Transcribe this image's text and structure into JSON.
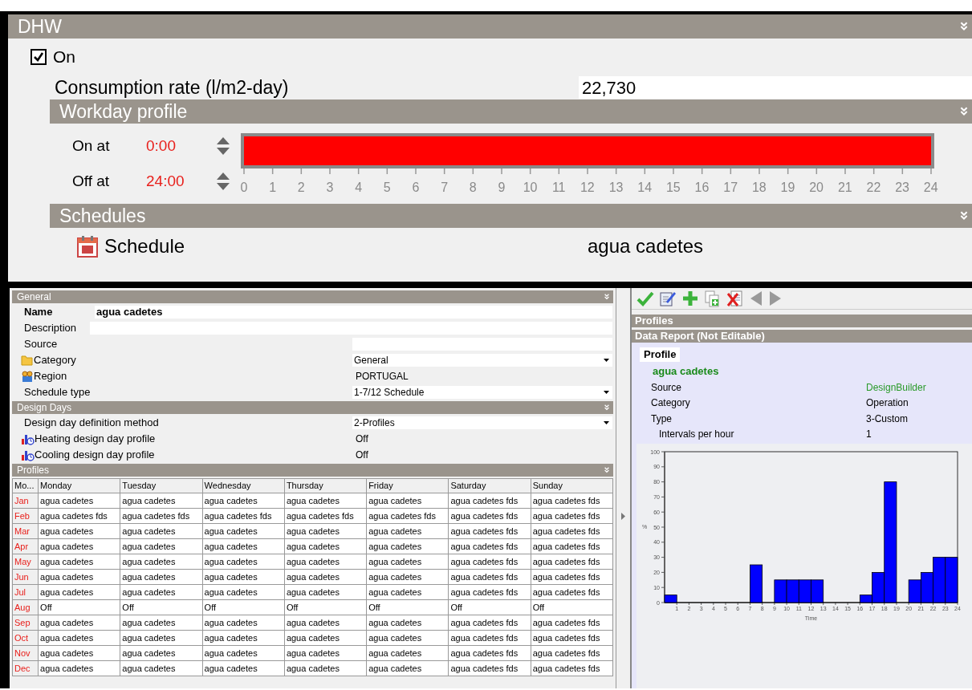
{
  "dhw": {
    "title": "DHW",
    "on": {
      "label": "On",
      "checked": true
    },
    "consumption": {
      "label": "Consumption rate (l/m2-day)",
      "value": "22,730"
    },
    "workday": {
      "title": "Workday profile",
      "on_label": "On at",
      "on_value": "0:00",
      "off_label": "Off at",
      "off_value": "24:00",
      "level": 1,
      "ticks": [
        "0",
        "1",
        "2",
        "3",
        "4",
        "5",
        "6",
        "7",
        "8",
        "9",
        "10",
        "11",
        "12",
        "13",
        "14",
        "15",
        "16",
        "17",
        "18",
        "19",
        "20",
        "21",
        "22",
        "23",
        "24"
      ]
    },
    "schedules": {
      "title": "Schedules",
      "label": "Schedule",
      "value": "agua cadetes"
    }
  },
  "general": {
    "title": "General",
    "fields": [
      {
        "label": "Name",
        "value": "agua cadetes",
        "kind": "name"
      },
      {
        "label": "Description",
        "kind": "wide"
      },
      {
        "label": "Source",
        "kind": "field"
      },
      {
        "label": "Category",
        "value": "General",
        "kind": "dropdown"
      },
      {
        "label": "Region",
        "value": "PORTUGAL",
        "kind": "text"
      },
      {
        "label": "Schedule type",
        "value": "1-7/12 Schedule",
        "kind": "dropdown"
      }
    ]
  },
  "design_days": {
    "title": "Design Days",
    "fields": [
      {
        "label": "Design day definition method",
        "value": "2-Profiles",
        "kind": "dropdown"
      },
      {
        "label": "Heating design day profile",
        "value": "Off",
        "kind": "text"
      },
      {
        "label": "Cooling design day profile",
        "value": "Off",
        "kind": "text"
      }
    ]
  },
  "profiles": {
    "title": "Profiles",
    "columns": [
      "Mo...",
      "Monday",
      "Tuesday",
      "Wednesday",
      "Thursday",
      "Friday",
      "Saturday",
      "Sunday"
    ],
    "rows": [
      [
        "Jan",
        "agua cadetes",
        "agua cadetes",
        "agua cadetes",
        "agua cadetes",
        "agua cadetes",
        "agua cadetes fds",
        "agua cadetes fds"
      ],
      [
        "Feb",
        "agua cadetes fds",
        "agua cadetes fds",
        "agua cadetes fds",
        "agua cadetes fds",
        "agua cadetes fds",
        "agua cadetes fds",
        "agua cadetes fds"
      ],
      [
        "Mar",
        "agua cadetes",
        "agua cadetes",
        "agua cadetes",
        "agua cadetes",
        "agua cadetes",
        "agua cadetes fds",
        "agua cadetes fds"
      ],
      [
        "Apr",
        "agua cadetes",
        "agua cadetes",
        "agua cadetes",
        "agua cadetes",
        "agua cadetes",
        "agua cadetes fds",
        "agua cadetes fds"
      ],
      [
        "May",
        "agua cadetes",
        "agua cadetes",
        "agua cadetes",
        "agua cadetes",
        "agua cadetes",
        "agua cadetes fds",
        "agua cadetes fds"
      ],
      [
        "Jun",
        "agua cadetes",
        "agua cadetes",
        "agua cadetes",
        "agua cadetes",
        "agua cadetes",
        "agua cadetes fds",
        "agua cadetes fds"
      ],
      [
        "Jul",
        "agua cadetes",
        "agua cadetes",
        "agua cadetes",
        "agua cadetes",
        "agua cadetes",
        "agua cadetes fds",
        "agua cadetes fds"
      ],
      [
        "Aug",
        "Off",
        "Off",
        "Off",
        "Off",
        "Off",
        "Off",
        "Off"
      ],
      [
        "Sep",
        "agua cadetes",
        "agua cadetes",
        "agua cadetes",
        "agua cadetes",
        "agua cadetes",
        "agua cadetes fds",
        "agua cadetes fds"
      ],
      [
        "Oct",
        "agua cadetes",
        "agua cadetes",
        "agua cadetes",
        "agua cadetes",
        "agua cadetes",
        "agua cadetes fds",
        "agua cadetes fds"
      ],
      [
        "Nov",
        "agua cadetes",
        "agua cadetes",
        "agua cadetes",
        "agua cadetes",
        "agua cadetes",
        "agua cadetes fds",
        "agua cadetes fds"
      ],
      [
        "Dec",
        "agua cadetes",
        "agua cadetes",
        "agua cadetes",
        "agua cadetes",
        "agua cadetes",
        "agua cadetes fds",
        "agua cadetes fds"
      ]
    ]
  },
  "right": {
    "profiles_title": "Profiles",
    "report_title": "Data Report (Not Editable)",
    "tab": "Profile",
    "name": "agua cadetes",
    "rows": [
      {
        "label": "Source",
        "value": "DesignBuilder",
        "kind": "link"
      },
      {
        "label": "Category",
        "value": "Operation",
        "kind": "text"
      },
      {
        "label": "Type",
        "value": "3-Custom",
        "kind": "text"
      },
      {
        "label": "Intervals per hour",
        "value": "1",
        "kind": "sub"
      }
    ],
    "chart_data": {
      "type": "bar",
      "xlabel": "Time",
      "ylabel": "%",
      "x": [
        0.5,
        1.5,
        2.5,
        3.5,
        4.5,
        5.5,
        6.5,
        7.5,
        8.5,
        9.5,
        10.5,
        11.5,
        12.5,
        13.5,
        14.5,
        15.5,
        16.5,
        17.5,
        18.5,
        19.5,
        20.5,
        21.5,
        22.5,
        23.5
      ],
      "values": [
        5,
        0,
        0,
        0,
        0,
        0,
        0,
        25,
        0,
        15,
        15,
        15,
        15,
        0,
        0,
        0,
        5,
        20,
        80,
        0,
        15,
        20,
        30,
        30
      ],
      "xlim": [
        0,
        24
      ],
      "ylim": [
        0,
        100
      ],
      "xticks": [
        1,
        2,
        3,
        4,
        5,
        6,
        7,
        8,
        9,
        10,
        11,
        12,
        13,
        14,
        15,
        16,
        17,
        18,
        19,
        20,
        21,
        22,
        23,
        24
      ],
      "yticks": [
        0,
        10,
        20,
        30,
        40,
        50,
        60,
        70,
        80,
        90,
        100
      ]
    }
  }
}
